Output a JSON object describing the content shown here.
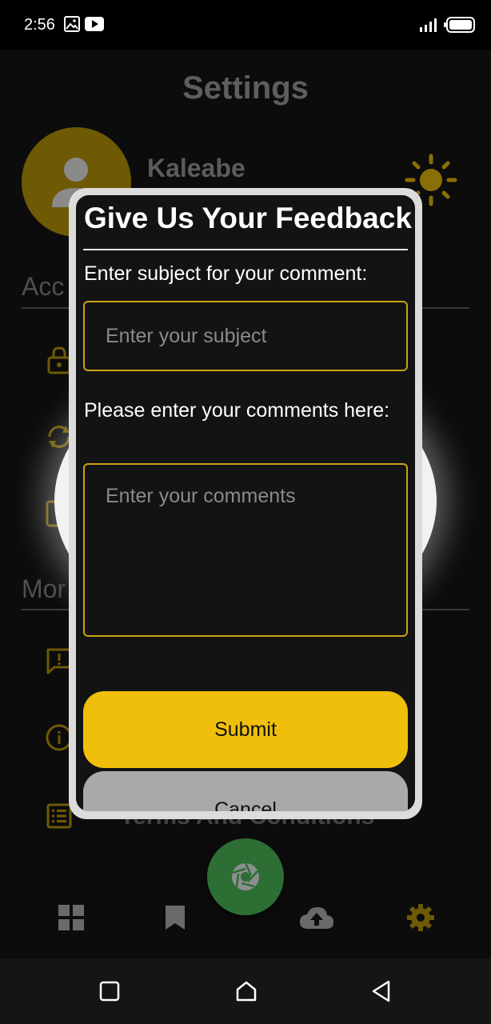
{
  "status": {
    "time": "2:56"
  },
  "screen": {
    "title": "Settings",
    "profile": {
      "name": "Kaleabe"
    },
    "sections": [
      {
        "label": "Acc"
      },
      {
        "label": "Mor"
      }
    ],
    "partial_item_text": "Terms And Conditions"
  },
  "dialog": {
    "title": "Give Us Your Feedback",
    "subject_label": "Enter subject for your comment:",
    "subject_placeholder": "Enter your subject",
    "comments_label": "Please enter your comments here:",
    "comments_placeholder": "Enter your comments",
    "submit_label": "Submit",
    "cancel_label": "Cancel"
  },
  "colors": {
    "accent": "#f0bf0b",
    "fab": "#2d6e34",
    "dialog_bg": "#131313"
  }
}
